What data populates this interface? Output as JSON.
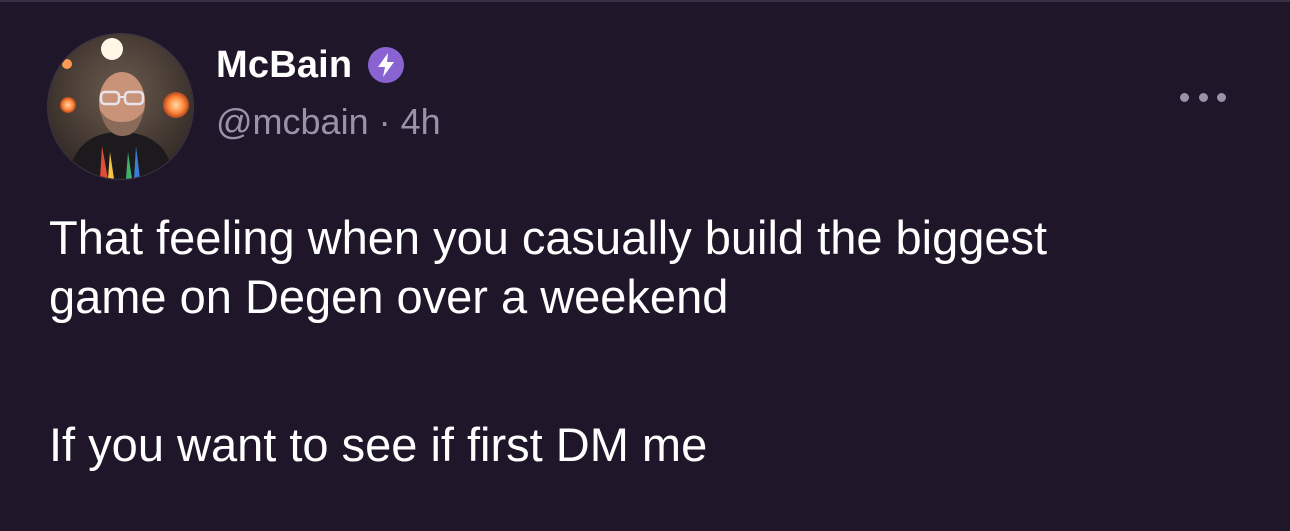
{
  "post": {
    "author": {
      "display_name": "McBain",
      "handle": "@mcbain",
      "separator": "·",
      "time": "4h",
      "badge_icon": "lightning-bolt-icon",
      "badge_color": "#8a63d2",
      "avatar_icon": "user-photo-avatar"
    },
    "more_icon": "more-horizontal-icon",
    "text": {
      "line1": "That feeling when you casually build the biggest",
      "line2": "game on Degen over a weekend",
      "line3": "If you want to see if first DM me"
    }
  },
  "colors": {
    "background": "#1f1629",
    "text_primary": "#ffffff",
    "text_secondary": "#9b92a9"
  }
}
